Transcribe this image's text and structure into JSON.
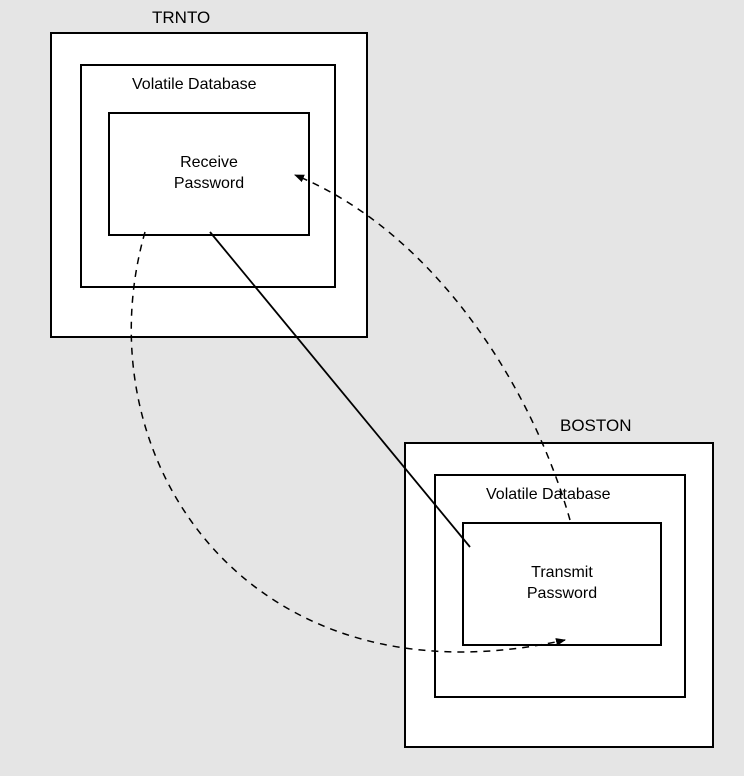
{
  "nodes": {
    "trnto": {
      "title": "TRNTO",
      "db_label": "Volatile Database",
      "inner_label": "Receive\nPassword"
    },
    "boston": {
      "title": "BOSTON",
      "db_label": "Volatile Database",
      "inner_label": "Transmit\nPassword"
    }
  }
}
